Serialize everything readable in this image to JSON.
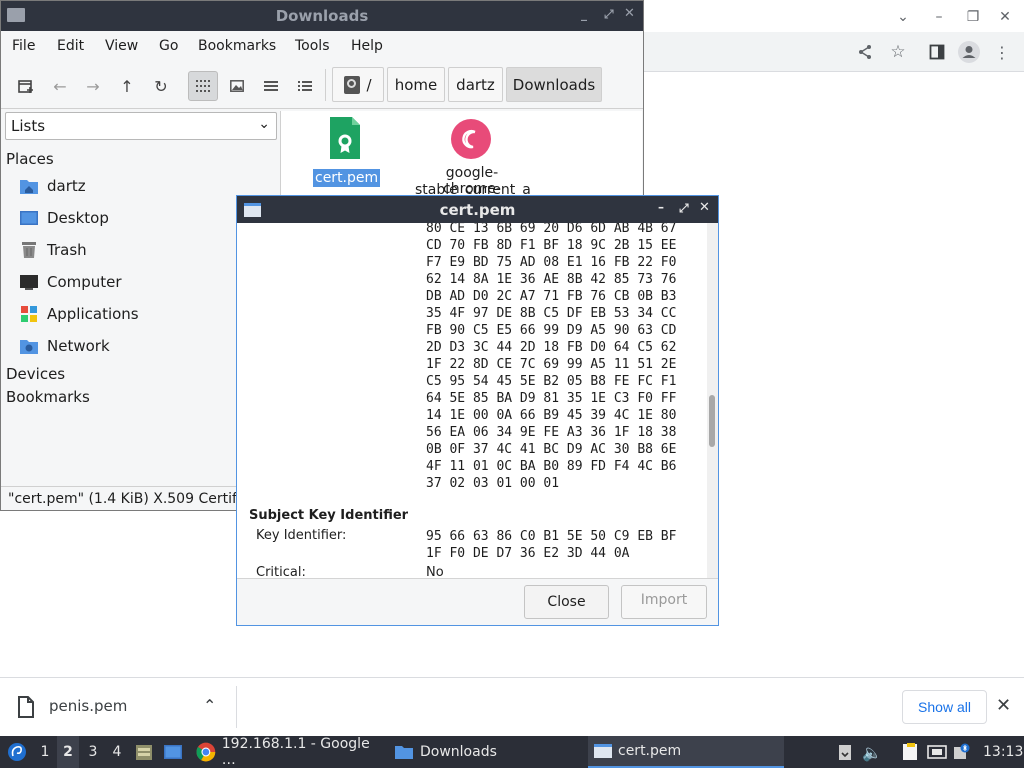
{
  "chrome": {
    "window_controls": [
      "chevron-down",
      "minimize",
      "restore",
      "close"
    ],
    "toolbar_icons": [
      "share",
      "bookmark-star",
      "side-panel",
      "profile",
      "more"
    ]
  },
  "file_manager": {
    "title": "Downloads",
    "menu": [
      "File",
      "Edit",
      "View",
      "Go",
      "Bookmarks",
      "Tools",
      "Help"
    ],
    "breadcrumbs": [
      "/",
      "home",
      "dartz",
      "Downloads"
    ],
    "sidebar_mode": "Lists",
    "places_heading": "Places",
    "places": [
      "dartz",
      "Desktop",
      "Trash",
      "Computer",
      "Applications",
      "Network"
    ],
    "devices_heading": "Devices",
    "bookmarks_heading": "Bookmarks",
    "files": [
      {
        "name": "cert.pem",
        "selected": true,
        "icon": "certificate-icon"
      },
      {
        "name_line1": "google-chrome-",
        "name_line2": "stable_current_a",
        "selected": false,
        "icon": "debian-package-icon"
      }
    ],
    "status": "\"cert.pem\" (1.4 KiB) X.509 Certific"
  },
  "dialog": {
    "title": "cert.pem",
    "hex_lines": [
      "80 CE 13 6B 69 20 D6 6D AB 4B 67",
      "CD 70 FB 8D F1 BF 18 9C 2B 15 EE",
      "F7 E9 BD 75 AD 08 E1 16 FB 22 F0",
      "62 14 8A 1E 36 AE 8B 42 85 73 76",
      "DB AD D0 2C A7 71 FB 76 CB 0B B3",
      "35 4F 97 DE 8B C5 DF EB 53 34 CC",
      "FB 90 C5 E5 66 99 D9 A5 90 63 CD",
      "2D D3 3C 44 2D 18 FB D0 64 C5 62",
      "1F 22 8D CE 7C 69 99 A5 11 51 2E",
      "C5 95 54 45 5E B2 05 B8 FE FC F1",
      "64 5E 85 BA D9 81 35 1E C3 F0 FF",
      "14 1E 00 0A 66 B9 45 39 4C 1E 80",
      "56 EA 06 34 9E FE A3 36 1F 18 38",
      "0B 0F 37 4C 41 BC D9 AC 30 B8 6E",
      "4F 11 01 0C BA B0 89 FD F4 4C B6",
      "37 02 03 01 00 01"
    ],
    "section_heading": "Subject Key Identifier",
    "key_id_label": "Key Identifier:",
    "key_id_line1": "95 66 63 86 C0 B1 5E 50 C9 EB BF",
    "key_id_line2": "1F F0 DE D7 36 E2 3D 44 0A",
    "critical_label": "Critical:",
    "critical_value": "No",
    "close_label": "Close",
    "import_label": "Import"
  },
  "download_shelf": {
    "file_name": "penis.pem",
    "show_all_label": "Show all"
  },
  "taskbar": {
    "workspaces": [
      "1",
      "2",
      "3",
      "4"
    ],
    "active_workspace": "2",
    "tasks": [
      "192.168.1.1 - Google …",
      "Downloads",
      "cert.pem"
    ],
    "clock": "13:13"
  },
  "colors": {
    "titlebar": "#2f343f",
    "selection": "#5294e2",
    "link_blue": "#1a73e8",
    "panel": "#2b2e37"
  }
}
